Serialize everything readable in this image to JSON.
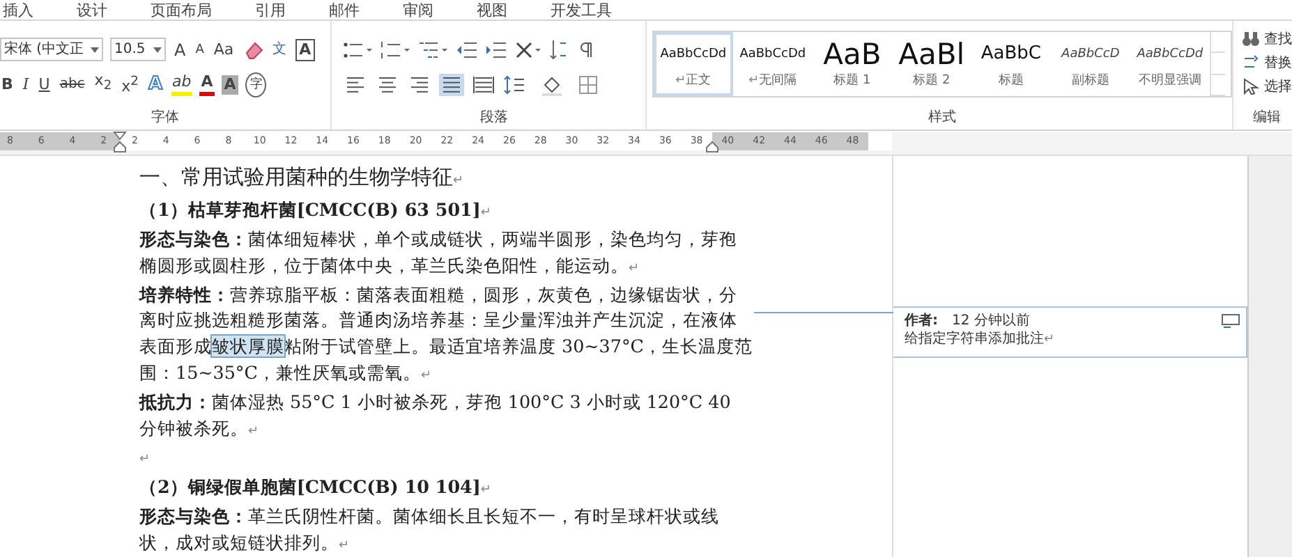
{
  "tabs": [
    {
      "label": "插入"
    },
    {
      "label": "设计"
    },
    {
      "label": "页面布局"
    },
    {
      "label": "引用"
    },
    {
      "label": "邮件"
    },
    {
      "label": "审阅"
    },
    {
      "label": "视图"
    },
    {
      "label": "开发工具"
    }
  ],
  "font_group": {
    "label": "字体",
    "font_name": "宋体 (中文正",
    "font_size": "10.5",
    "row1": [
      {
        "kind": "grow",
        "label": "A"
      },
      {
        "kind": "shrink",
        "label": "A"
      },
      {
        "kind": "case",
        "label": "Aa"
      },
      {
        "kind": "clear"
      },
      {
        "kind": "phonetic",
        "label": "文"
      },
      {
        "kind": "border",
        "label": "A"
      }
    ],
    "row2": [
      {
        "kind": "bold",
        "label": "B"
      },
      {
        "kind": "italic",
        "label": "I"
      },
      {
        "kind": "underline",
        "label": "U"
      },
      {
        "kind": "strike",
        "label": "abc"
      },
      {
        "kind": "sub",
        "label": "x$_{2}$"
      },
      {
        "kind": "sup",
        "label": "x$^{2}$"
      },
      {
        "kind": "effect",
        "label": "A"
      },
      {
        "kind": "highlight",
        "label": "ab"
      },
      {
        "kind": "color",
        "label": "A"
      },
      {
        "kind": "shade",
        "label": "A"
      },
      {
        "kind": "enclose",
        "label": "字"
      }
    ]
  },
  "paragraph_group": {
    "label": "段落",
    "alignment": [
      {
        "kind": "left",
        "selected": false
      },
      {
        "kind": "center",
        "selected": false
      },
      {
        "kind": "right",
        "selected": false
      },
      {
        "kind": "justify",
        "selected": true
      },
      {
        "kind": "distributed",
        "selected": false
      }
    ]
  },
  "styles_group": {
    "label": "样式",
    "items": [
      {
        "preview": "AaBbCcDd",
        "name": "正文",
        "kind": "small",
        "italic": false,
        "selected": true,
        "mark": "↵"
      },
      {
        "preview": "AaBbCcDd",
        "name": "无间隔",
        "kind": "small",
        "italic": false,
        "selected": false,
        "mark": "↵"
      },
      {
        "preview": "AaB",
        "name": "标题 1",
        "kind": "large",
        "italic": false,
        "selected": false
      },
      {
        "preview": "AaBl",
        "name": "标题 2",
        "kind": "large",
        "italic": false,
        "selected": false
      },
      {
        "preview": "AaBbC",
        "name": "标题",
        "kind": "medium",
        "italic": false,
        "selected": false
      },
      {
        "preview": "AaBbCcD",
        "name": "副标题",
        "kind": "small",
        "italic": true,
        "selected": false
      },
      {
        "preview": "AaBbCcDd",
        "name": "不明显强调",
        "kind": "small",
        "italic": true,
        "selected": false
      }
    ]
  },
  "editing_group": {
    "label": "编辑",
    "items": [
      {
        "kind": "find",
        "label": "查找"
      },
      {
        "kind": "replace",
        "label": "替换"
      },
      {
        "kind": "select",
        "label": "选择"
      }
    ]
  },
  "ruler": {
    "ticks": [
      {
        "label": "8",
        "margin": true
      },
      {
        "label": "6",
        "margin": true
      },
      {
        "label": "4",
        "margin": true
      },
      {
        "label": "2",
        "margin": true
      },
      {
        "label": "2",
        "margin": false
      },
      {
        "label": "4",
        "margin": false
      },
      {
        "label": "6",
        "margin": false
      },
      {
        "label": "8",
        "margin": false
      },
      {
        "label": "10",
        "margin": false
      },
      {
        "label": "12",
        "margin": false
      },
      {
        "label": "14",
        "margin": false
      },
      {
        "label": "16",
        "margin": false
      },
      {
        "label": "18",
        "margin": false
      },
      {
        "label": "20",
        "margin": false
      },
      {
        "label": "22",
        "margin": false
      },
      {
        "label": "24",
        "margin": false
      },
      {
        "label": "26",
        "margin": false
      },
      {
        "label": "28",
        "margin": false
      },
      {
        "label": "30",
        "margin": false
      },
      {
        "label": "32",
        "margin": false
      },
      {
        "label": "34",
        "margin": false
      },
      {
        "label": "36",
        "margin": false
      },
      {
        "label": "38",
        "margin": false
      },
      {
        "label": "40",
        "margin": true
      },
      {
        "label": "42",
        "margin": true
      },
      {
        "label": "44",
        "margin": true
      },
      {
        "label": "46",
        "margin": true
      },
      {
        "label": "48",
        "margin": true
      }
    ]
  },
  "document": {
    "paragraph_mark": "↵",
    "paragraphs": [
      {
        "kind": "heading",
        "runs": [
          {
            "text": "一、常用试验用菌种的生物学特征",
            "commented": false
          }
        ]
      },
      {
        "kind": "subheading",
        "runs": [
          {
            "text": "（1）枯草芽孢杆菌[CMCC(B) 63 501]",
            "commented": false
          }
        ]
      },
      {
        "kind": "body",
        "runs": [
          {
            "text": "**形态与染色：**菌体细短棒状，单个或成链状，两端半圆形，染色均匀，芽孢椭圆形或圆柱形，位于菌体中央，革兰氏染色阳性，能运动。",
            "commented": false
          }
        ]
      },
      {
        "kind": "body",
        "runs": [
          {
            "text": "**培养特性：**营养琼脂平板：菌落表面粗糙，圆形，灰黄色，边缘锯齿状，分离时应挑选粗糙形菌落。普通肉汤培养基：呈少量浑浊并产生沉淀，在液体表面形成",
            "commented": false
          },
          {
            "text": "皱状厚膜",
            "commented": true
          },
          {
            "text": "粘附于试管壁上。最适宜培养温度 30~37°C，生长温度范围：15~35°C，兼性厌氧或需氧。",
            "commented": false
          }
        ]
      },
      {
        "kind": "body",
        "runs": [
          {
            "text": "**抵抗力：**菌体湿热 55°C 1 小时被杀死，芽孢 100°C 3 小时或 120°C 40 分钟被杀死。",
            "commented": false
          }
        ]
      },
      {
        "kind": "empty"
      },
      {
        "kind": "subheading",
        "runs": [
          {
            "text": "（2）铜绿假单胞菌[CMCC(B) 10 104]",
            "commented": false
          }
        ]
      },
      {
        "kind": "body",
        "runs": [
          {
            "text": "**形态与染色：**革兰氏阴性杆菌。菌体细长且长短不一，有时呈球杆状或线状，成对或短链状排列。",
            "commented": false
          }
        ]
      }
    ]
  },
  "comment": {
    "author": "作者:",
    "time": "12 分钟以前",
    "text": "给指定字符串添加批注",
    "mark": "↵"
  }
}
